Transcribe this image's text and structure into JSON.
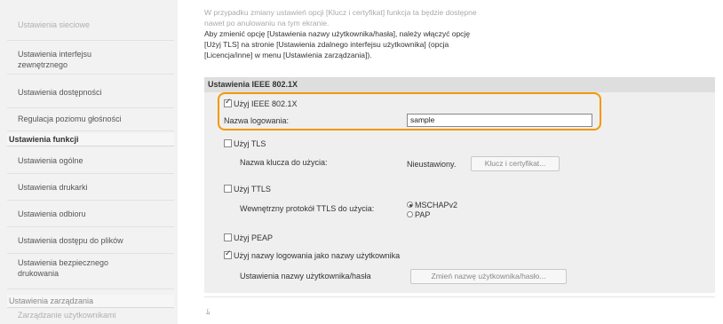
{
  "sidebar": {
    "items": [
      {
        "label": "Ustawienia sieciowe",
        "faded": true
      },
      {
        "label": "Ustawienia interfejsu zewnętrznego",
        "faded": false
      },
      {
        "label": "Ustawienia dostępności",
        "faded": false
      },
      {
        "label": "Regulacja poziomu głośności",
        "faded": false
      }
    ],
    "section_header": "Ustawienia funkcji",
    "section_items": [
      {
        "label": "Ustawienia ogólne"
      },
      {
        "label": "Ustawienia drukarki"
      },
      {
        "label": "Ustawienia odbioru"
      },
      {
        "label": "Ustawienia dostępu do plików"
      },
      {
        "label": "Ustawienia bezpiecznego drukowania"
      }
    ],
    "section2_header": "Ustawienia zarządzania",
    "section2_faded_item": "Zarządzanie użytkownikami"
  },
  "intro": {
    "line1": "W przypadku zmiany ustawień opcji [Klucz i certyfikat] funkcja ta będzie dostępne",
    "line2": "nawet po anulowaniu na tym ekranie.",
    "line3": "Aby zmienić opcję [Ustawienia nazwy użytkownika/hasła], należy włączyć opcję",
    "line4": "[Użyj TLS] na stronie [Ustawienia zdalnego interfejsu użytkownika] (opcja",
    "line5": "[Licencja/inne] w menu [Ustawienia zarządzania])."
  },
  "section": {
    "title": "Ustawienia IEEE 802.1X",
    "use_ieee_label": "Użyj IEEE 802.1X",
    "login_name_label": "Nazwa logowania:",
    "login_name_value": "sample",
    "use_tls_label": "Użyj TLS",
    "key_label": "Nazwa klucza do użycia:",
    "key_status": "Nieustawiony.",
    "key_button": "Klucz i certyfikat...",
    "use_ttls_label": "Użyj TTLS",
    "ttls_protocol_label": "Wewnętrzny protokół TTLS do użycia:",
    "mschap_label": "MSCHAPv2",
    "pap_label": "PAP",
    "use_peap_label": "Użyj PEAP",
    "use_login_as_user_label": "Użyj nazwy logowania jako nazwy użytkownika",
    "user_settings_label": "Ustawienia nazwy użytkownika/hasła",
    "user_settings_button": "Zmień nazwę użytkownika/hasło..."
  },
  "footer": {
    "mark": "ﾑ"
  }
}
